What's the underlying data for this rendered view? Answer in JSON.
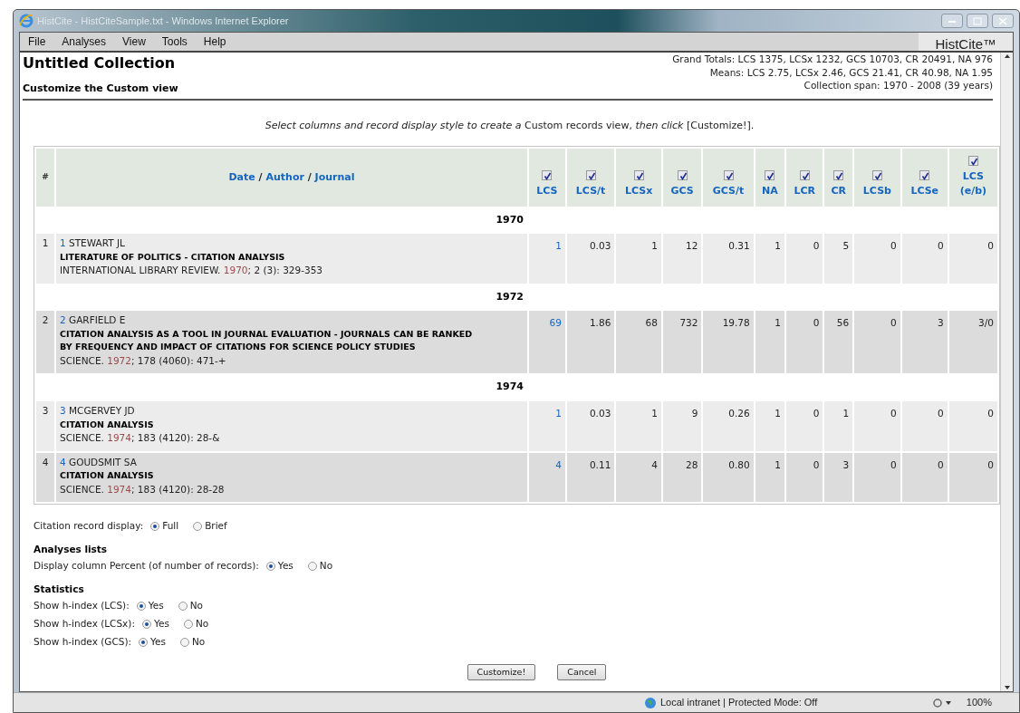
{
  "window": {
    "title": "HistCite - HistCiteSample.txt - Windows Internet Explorer"
  },
  "menu": [
    "File",
    "Analyses",
    "View",
    "Tools",
    "Help"
  ],
  "brand": "HistCite™",
  "collection": {
    "title": "Untitled Collection",
    "subtitle": "Customize the Custom view",
    "stats": [
      "Grand Totals: LCS 1375, LCSx 1232, GCS 10703, CR 20491, NA 976",
      "Means: LCS 2.75, LCSx 2.46, GCS 21.41, CR 40.98, NA 1.95",
      "Collection span: 1970 - 2008 (39 years)"
    ]
  },
  "instruction": "*Select columns and record display style to create a* Custom records view, *then click* [Customize!].",
  "table": {
    "index_header": "#",
    "main_header": [
      "Date",
      "Author",
      "Journal"
    ],
    "separator": "/",
    "columns": [
      {
        "label": "LCS",
        "checked": true,
        "linked": true
      },
      {
        "label": "LCS/t",
        "checked": true,
        "linked": false
      },
      {
        "label": "LCSx",
        "checked": true,
        "linked": false
      },
      {
        "label": "GCS",
        "checked": true,
        "linked": false
      },
      {
        "label": "GCS/t",
        "checked": true,
        "linked": false
      },
      {
        "label": "NA",
        "checked": true,
        "linked": false
      },
      {
        "label": "LCR",
        "checked": true,
        "linked": false
      },
      {
        "label": "CR",
        "checked": true,
        "linked": false
      },
      {
        "label": "LCSb",
        "checked": true,
        "linked": false
      },
      {
        "label": "LCSe",
        "checked": true,
        "linked": false
      },
      {
        "label": "LCS (e/b)",
        "checked": true,
        "linked": false
      }
    ],
    "rows": [
      {
        "kind": "year",
        "label": "1970"
      },
      {
        "kind": "record",
        "index": "1",
        "ref": "1",
        "author": "STEWART JL",
        "title": "LITERATURE OF POLITICS - CITATION ANALYSIS",
        "source": "INTERNATIONAL LIBRARY REVIEW. *1970*; 2 (3): 329-353",
        "values": [
          "1",
          "0.03",
          "1",
          "12",
          "0.31",
          "1",
          "0",
          "5",
          "0",
          "0",
          "0"
        ]
      },
      {
        "kind": "year",
        "label": "1972"
      },
      {
        "kind": "record",
        "index": "2",
        "ref": "2",
        "author": "GARFIELD E",
        "title": "CITATION ANALYSIS AS A TOOL IN JOURNAL EVALUATION - JOURNALS CAN BE RANKED BY FREQUENCY AND IMPACT OF CITATIONS FOR SCIENCE POLICY STUDIES",
        "source": "SCIENCE. *1972*; 178 (4060): 471-+",
        "values": [
          "69",
          "1.86",
          "68",
          "732",
          "19.78",
          "1",
          "0",
          "56",
          "0",
          "3",
          "3/0"
        ]
      },
      {
        "kind": "year",
        "label": "1974"
      },
      {
        "kind": "record",
        "index": "3",
        "ref": "3",
        "author": "MCGERVEY JD",
        "title": "CITATION ANALYSIS",
        "source": "SCIENCE. *1974*; 183 (4120): 28-&",
        "values": [
          "1",
          "0.03",
          "1",
          "9",
          "0.26",
          "1",
          "0",
          "1",
          "0",
          "0",
          "0"
        ]
      },
      {
        "kind": "record",
        "index": "4",
        "ref": "4",
        "author": "GOUDSMIT SA",
        "title": "CITATION ANALYSIS",
        "source": "SCIENCE. *1974*; 183 (4120): 28-28",
        "values": [
          "4",
          "0.11",
          "4",
          "28",
          "0.80",
          "1",
          "0",
          "3",
          "0",
          "0",
          "0"
        ]
      }
    ]
  },
  "options": [
    {
      "kind": "radio",
      "label": "Citation record display:",
      "choices": [
        {
          "label": "Full",
          "selected": true
        },
        {
          "label": "Brief",
          "selected": false
        }
      ]
    },
    {
      "kind": "heading",
      "label": "Analyses lists"
    },
    {
      "kind": "radio",
      "label": "Display column Percent (of number of records):",
      "choices": [
        {
          "label": "Yes",
          "selected": true
        },
        {
          "label": "No",
          "selected": false
        }
      ]
    },
    {
      "kind": "heading",
      "label": "Statistics"
    },
    {
      "kind": "radio",
      "label": "Show h-index (LCS):",
      "choices": [
        {
          "label": "Yes",
          "selected": true
        },
        {
          "label": "No",
          "selected": false
        }
      ]
    },
    {
      "kind": "radio",
      "label": "Show h-index (LCSx):",
      "choices": [
        {
          "label": "Yes",
          "selected": true
        },
        {
          "label": "No",
          "selected": false
        }
      ]
    },
    {
      "kind": "radio",
      "label": "Show h-index (GCS):",
      "choices": [
        {
          "label": "Yes",
          "selected": true
        },
        {
          "label": "No",
          "selected": false
        }
      ]
    }
  ],
  "buttons": [
    "Customize!",
    "Cancel"
  ],
  "status_bar": {
    "zone": "Local intranet | Protected Mode: Off",
    "zoom": "100%"
  }
}
